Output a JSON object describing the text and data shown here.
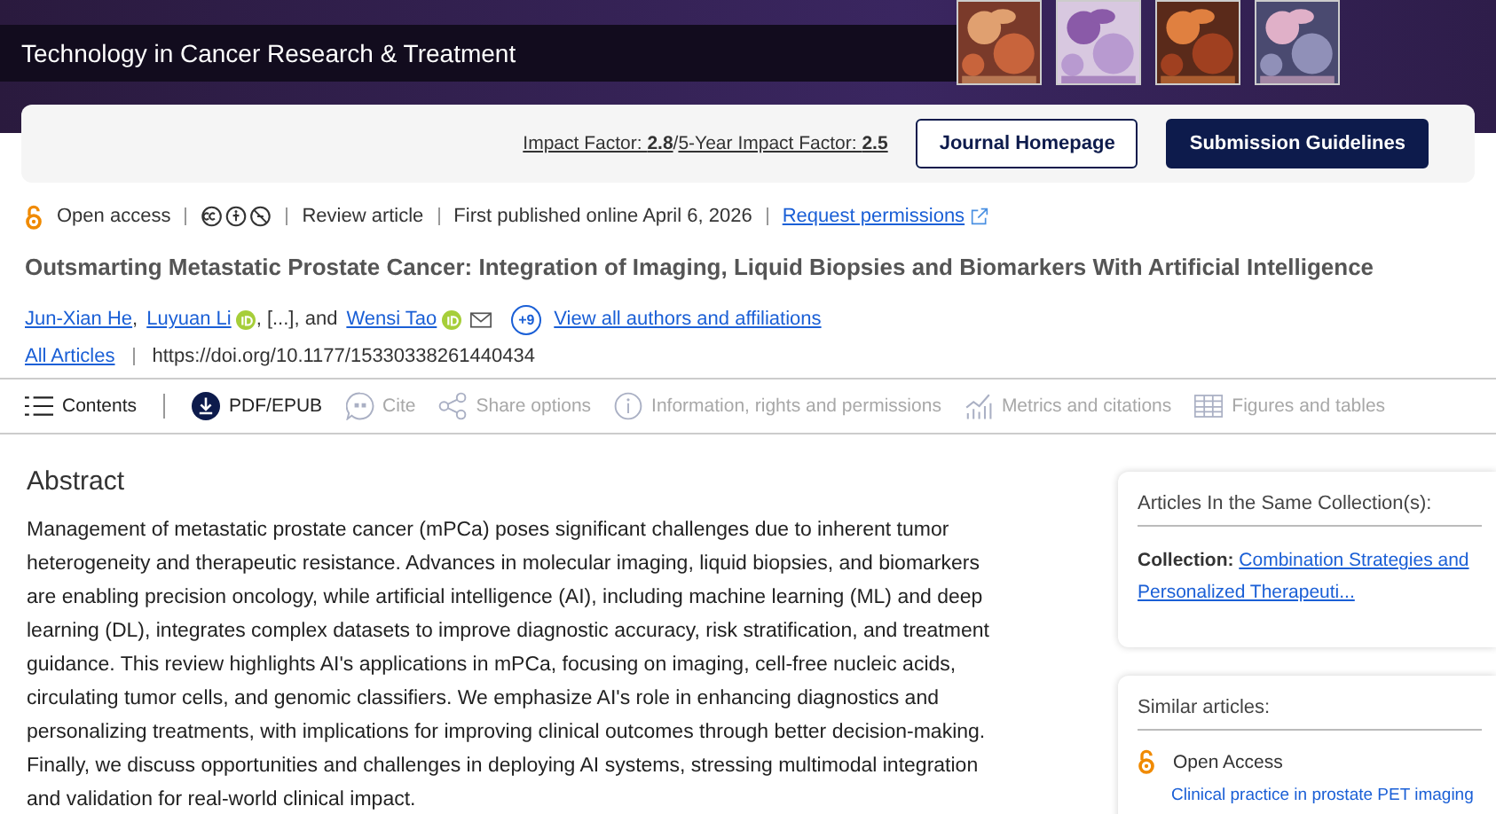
{
  "journal": {
    "title": "Technology in Cancer Research & Treatment"
  },
  "journal_bar": {
    "impact_label": "Impact Factor: ",
    "impact_value": "2.8",
    "divider": "/",
    "five_year_label": "5-Year Impact Factor: ",
    "five_year_value": "2.5",
    "buttons": [
      {
        "label": "Journal Homepage",
        "kind": "outline"
      },
      {
        "label": "Submission Guidelines",
        "kind": "filled"
      }
    ]
  },
  "meta": {
    "access": "Open access",
    "type": "Review article",
    "published": "First published online April 6, 2026",
    "permissions": "Request permissions"
  },
  "article_title": "Outsmarting Metastatic Prostate Cancer: Integration of Imaging, Liquid Biopsies and Biomarkers With Artificial Intelligence",
  "authors": [
    {
      "name": "Jun-Xian He",
      "after": ","
    },
    {
      "name": "Luyuan Li",
      "orcid": true,
      "after": ", [...], and"
    },
    {
      "name": "Wensi Tao",
      "orcid": true,
      "email": true
    }
  ],
  "more_authors": "+9",
  "view_all": "View all authors and affiliations",
  "all_articles": "All Articles",
  "doi": "https://doi.org/10.1177/15330338261440434",
  "toolbar": [
    {
      "label": "Contents",
      "kind": "contents",
      "disabled": false
    },
    {
      "label": "PDF/EPUB",
      "kind": "pdf",
      "disabled": false
    },
    {
      "label": "Cite",
      "kind": "cite",
      "disabled": true
    },
    {
      "label": "Share options",
      "kind": "share",
      "disabled": true
    },
    {
      "label": "Information, rights and permissions",
      "kind": "info",
      "disabled": true
    },
    {
      "label": "Metrics and citations",
      "kind": "metrics",
      "disabled": true
    },
    {
      "label": "Figures and tables",
      "kind": "table",
      "disabled": true
    }
  ],
  "abstract": {
    "heading": "Abstract",
    "text": "Management of metastatic prostate cancer (mPCa) poses significant challenges due to inherent tumor heterogeneity and therapeutic resistance. Advances in molecular imaging, liquid biopsies, and biomarkers are enabling precision oncology, while artificial intelligence (AI), including machine learning (ML) and deep learning (DL), integrates complex datasets to improve diagnostic accuracy, risk stratification, and treatment guidance. This review highlights AI's applications in mPCa, focusing on imaging, cell-free nucleic acids, circulating tumor cells, and genomic classifiers. We emphasize AI's role in enhancing diagnostics and personalizing treatments, with implications for improving clinical outcomes through better decision-making. Finally, we discuss opportunities and challenges in deploying AI systems, stressing multimodal integration and validation for real-world clinical impact."
  },
  "sidebar": {
    "collection_card": {
      "heading": "Articles In the Same Collection(s):",
      "label": "Collection:",
      "link": "Combination Strategies and Personalized Therapeuti..."
    },
    "similar_card": {
      "heading": "Similar articles:",
      "items": [
        {
          "access": "Open Access",
          "title": "Clinical practice in prostate PET imaging"
        }
      ]
    }
  }
}
